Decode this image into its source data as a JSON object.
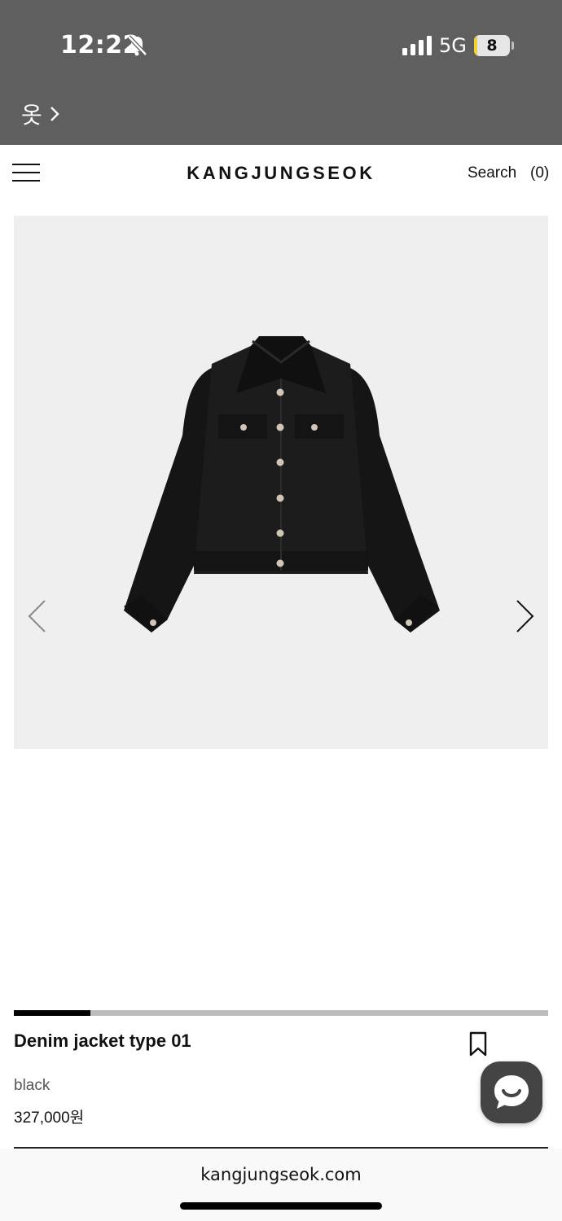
{
  "status": {
    "time": "12:22",
    "network": "5G",
    "battery": "8",
    "battery_fill_percent": 8,
    "back_app": "옷"
  },
  "header": {
    "logo": "KANGJUNGSEOK",
    "search_label": "Search",
    "cart_count": "(0)"
  },
  "gallery": {
    "image_icon": "denim-jacket-image",
    "slide_progress_fraction": 0.143
  },
  "product": {
    "name": "Denim jacket type 01",
    "color": "black",
    "price": "327,000원"
  },
  "browser": {
    "url": "kangjungseok.com"
  },
  "colors": {
    "status_bar_bg": "#5f5f5f",
    "gallery_bg": "#efefef",
    "battery_fill": "#f2d22e",
    "chat_button_bg": "#444444"
  }
}
